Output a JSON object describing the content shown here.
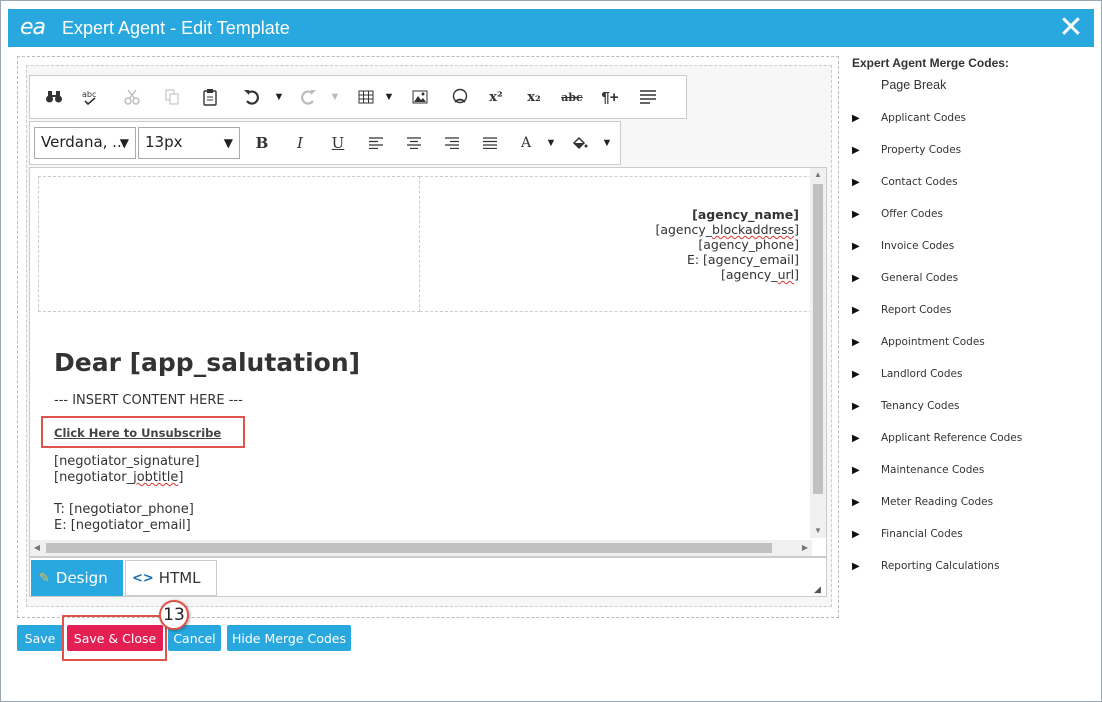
{
  "window": {
    "logo_text": "ea",
    "title": "Expert Agent - Edit Template",
    "close_icon": "close-icon"
  },
  "toolbar": {
    "font_family": "Verdana, ...",
    "font_size": "13px"
  },
  "document": {
    "header": {
      "agency_name": "[agency_name]",
      "agency_blockaddress_pre": "[agency_",
      "agency_blockaddress_mid": "blockaddress",
      "agency_blockaddress_post": "]",
      "agency_phone": "[agency_phone]",
      "agency_email": "E: [agency_email]",
      "agency_url_pre": "[agency_",
      "agency_url_mid": "url",
      "agency_url_post": "]"
    },
    "greeting": "Dear [app_salutation]",
    "insert_content": "--- INSERT CONTENT HERE ---",
    "unsubscribe": "Click Here to Unsubscribe",
    "signature": "[negotiator_signature]",
    "jobtitle_pre": "[negotiator_",
    "jobtitle_mid": "jobtitle",
    "jobtitle_post": "]",
    "phone": "T: [negotiator_phone]",
    "email": "E: [negotiator_email]"
  },
  "mode_tabs": {
    "design": "Design",
    "html": "HTML"
  },
  "buttons": {
    "save": "Save",
    "save_close": "Save & Close",
    "cancel": "Cancel",
    "hide_merge": "Hide Merge Codes"
  },
  "step_badge": "13",
  "merge_codes": {
    "title": "Expert Agent Merge Codes:",
    "page_break": "Page Break",
    "items": [
      "Applicant Codes",
      "Property Codes",
      "Contact Codes",
      "Offer Codes",
      "Invoice Codes",
      "General Codes",
      "Report Codes",
      "Appointment Codes",
      "Landlord Codes",
      "Tenancy Codes",
      "Applicant Reference Codes",
      "Maintenance Codes",
      "Meter Reading Codes",
      "Financial Codes",
      "Reporting Calculations"
    ]
  },
  "colors": {
    "brand_blue": "#29a8e0",
    "save_close_red": "#e41f54",
    "highlight_red": "#e0534a"
  }
}
